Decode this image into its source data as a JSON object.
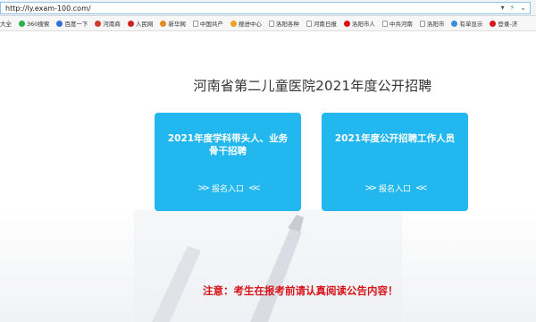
{
  "browser": {
    "url": "http://ly.exam-100.com/",
    "bookmarks": [
      {
        "label": "大全",
        "color": "#e6e6e6",
        "icon": "none"
      },
      {
        "label": "360搜索",
        "color": "#2bb34a",
        "icon": "360-icon"
      },
      {
        "label": "百度一下",
        "color": "#2f6fe0",
        "icon": "baidu-icon"
      },
      {
        "label": "河南商",
        "color": "#d23a2c",
        "icon": "site-icon"
      },
      {
        "label": "人民网",
        "color": "#cc2222",
        "icon": "site-icon"
      },
      {
        "label": "新华网",
        "color": "#e58a1c",
        "icon": "site-icon"
      },
      {
        "label": "中国共产",
        "color": "#ffffff",
        "icon": "page-icon"
      },
      {
        "label": "搜进中心",
        "color": "#f0a020",
        "icon": "site-icon"
      },
      {
        "label": "洛阳各种",
        "color": "#ffffff",
        "icon": "page-icon"
      },
      {
        "label": "河南日报",
        "color": "#ffffff",
        "icon": "page-icon"
      },
      {
        "label": "洛阳市人",
        "color": "#d8141a",
        "icon": "site-icon"
      },
      {
        "label": "中共河南",
        "color": "#ffffff",
        "icon": "page-icon"
      },
      {
        "label": "洛阳市",
        "color": "#ffffff",
        "icon": "page-icon"
      },
      {
        "label": "有单显示",
        "color": "#3a8fd8",
        "icon": "site-icon"
      },
      {
        "label": "登录-济",
        "color": "#d8141a",
        "icon": "site-icon"
      }
    ]
  },
  "page": {
    "title": "河南省第二儿童医院2021年度公开招聘",
    "cards": [
      {
        "title": "2021年度学科带头人、业务骨干招聘",
        "entry": "报名入口"
      },
      {
        "title": "2021年度公开招聘工作人员",
        "entry": "报名入口"
      }
    ],
    "notice": "注意：考生在报考前请认真阅读公告内容！"
  },
  "colors": {
    "card": "#23b7ef",
    "notice": "#d8141a"
  }
}
